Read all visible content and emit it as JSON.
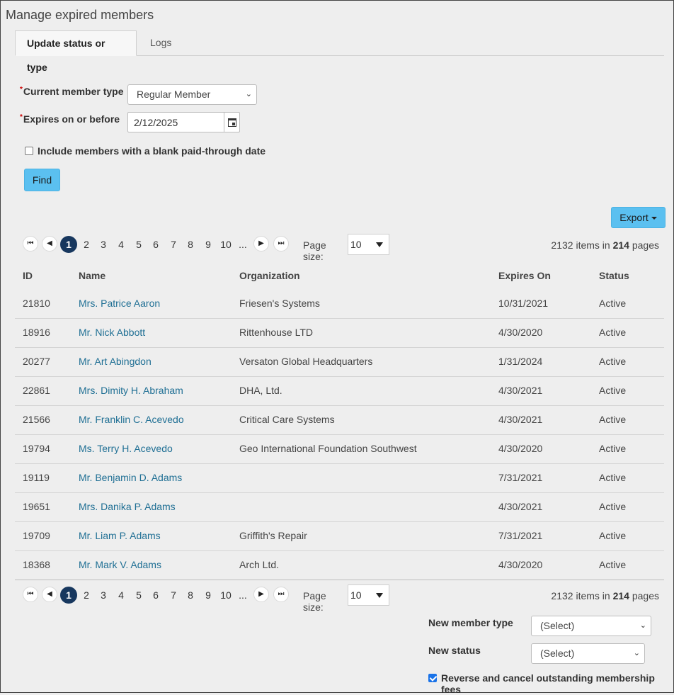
{
  "page_title": "Manage expired members",
  "tabs": [
    {
      "label": "Update status or type",
      "active": true
    },
    {
      "label": "Logs",
      "active": false
    }
  ],
  "form": {
    "current_member_type_label": "Current member type",
    "current_member_type_value": "Regular Member",
    "expires_label": "Expires on or before",
    "expires_value": "2/12/2025",
    "blank_date_label": "Include members with a blank paid-through date",
    "blank_date_checked": false,
    "find_label": "Find",
    "required_mark": "*"
  },
  "export_label": "Export",
  "pager": {
    "first_icon": "first-page-icon",
    "prev_icon": "prev-page-icon",
    "next_icon": "next-page-icon",
    "last_icon": "last-page-icon",
    "pages": [
      "1",
      "2",
      "3",
      "4",
      "5",
      "6",
      "7",
      "8",
      "9",
      "10",
      "..."
    ],
    "current_page": "1",
    "page_size_label": "Page size:",
    "page_size_value": "10",
    "total_items": "2132",
    "items_in_text": "items in",
    "total_pages": "214",
    "pages_text": "pages"
  },
  "table": {
    "columns": [
      "ID",
      "Name",
      "Organization",
      "Expires On",
      "Status"
    ],
    "rows": [
      {
        "id": "21810",
        "name": "Mrs. Patrice Aaron",
        "org": "Friesen's Systems",
        "expires": "10/31/2021",
        "status": "Active"
      },
      {
        "id": "18916",
        "name": "Mr. Nick Abbott",
        "org": "Rittenhouse LTD",
        "expires": "4/30/2020",
        "status": "Active"
      },
      {
        "id": "20277",
        "name": "Mr. Art Abingdon",
        "org": "Versaton Global Headquarters",
        "expires": "1/31/2024",
        "status": "Active"
      },
      {
        "id": "22861",
        "name": "Mrs. Dimity H. Abraham",
        "org": "DHA, Ltd.",
        "expires": "4/30/2021",
        "status": "Active"
      },
      {
        "id": "21566",
        "name": "Mr. Franklin C. Acevedo",
        "org": "Critical Care Systems",
        "expires": "4/30/2021",
        "status": "Active"
      },
      {
        "id": "19794",
        "name": "Ms. Terry H. Acevedo",
        "org": "Geo International Foundation Southwest",
        "expires": "4/30/2020",
        "status": "Active"
      },
      {
        "id": "19119",
        "name": "Mr. Benjamin D. Adams",
        "org": "",
        "expires": "7/31/2021",
        "status": "Active"
      },
      {
        "id": "19651",
        "name": "Mrs. Danika P. Adams",
        "org": "",
        "expires": "4/30/2021",
        "status": "Active"
      },
      {
        "id": "19709",
        "name": "Mr. Liam P. Adams",
        "org": "Griffith's Repair",
        "expires": "7/31/2021",
        "status": "Active"
      },
      {
        "id": "18368",
        "name": "Mr. Mark V. Adams",
        "org": "Arch Ltd.",
        "expires": "4/30/2020",
        "status": "Active"
      }
    ]
  },
  "bottom": {
    "new_member_type_label": "New member type",
    "new_member_type_value": "(Select)",
    "new_status_label": "New status",
    "new_status_value": "(Select)",
    "reverse_label": "Reverse and cancel outstanding membership fees",
    "reverse_checked": true
  },
  "colors": {
    "accent_button": "#5bc0f0",
    "link": "#1f6f94",
    "active_page": "#17375e",
    "required": "#cc0000",
    "background": "#eeeeee"
  }
}
